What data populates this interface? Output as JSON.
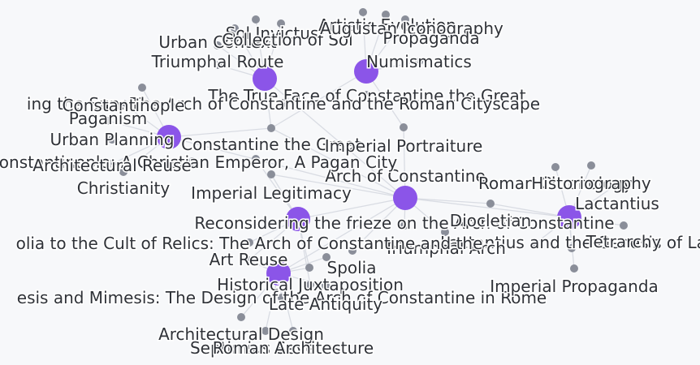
{
  "colors": {
    "hub": "#8b55e8",
    "leaf": "#8a8e99",
    "edge": "#d9dce3",
    "label": "#2f3238",
    "background": "#f7f8fa"
  },
  "nodes": [
    {
      "id": "arch",
      "kind": "hub",
      "label": "Arch of Constantine"
    },
    {
      "id": "truefaceH",
      "kind": "hub",
      "label": ""
    },
    {
      "id": "numisH",
      "kind": "hub",
      "label": ""
    },
    {
      "id": "cityH",
      "kind": "hub",
      "label": ""
    },
    {
      "id": "friezeH",
      "kind": "hub",
      "label": ""
    },
    {
      "id": "spoliaH",
      "kind": "hub",
      "label": ""
    },
    {
      "id": "lactH",
      "kind": "hub",
      "label": ""
    },
    {
      "id": "urbanctx",
      "kind": "leaf",
      "label": "Urban Context"
    },
    {
      "id": "triroute",
      "kind": "leaf",
      "label": "Triumphal Route"
    },
    {
      "id": "soliinv",
      "kind": "leaf",
      "label": "Sol Invictus"
    },
    {
      "id": "coll",
      "kind": "leaf",
      "label": "Collection of Sol"
    },
    {
      "id": "artevo",
      "kind": "leaf",
      "label": "Artistic Evolution"
    },
    {
      "id": "augico",
      "kind": "leaf",
      "label": "Augustan Iconography"
    },
    {
      "id": "prop",
      "kind": "leaf",
      "label": "Propaganda"
    },
    {
      "id": "numis",
      "kind": "leaf",
      "label": "Numismatics"
    },
    {
      "id": "trueface",
      "kind": "leaf",
      "label": "The True Face of Constantine the Great"
    },
    {
      "id": "sunarch",
      "kind": "leaf",
      "label": "ing the Sun: The Arch of Constantine and the Roman Cityscape"
    },
    {
      "id": "constop",
      "kind": "leaf",
      "label": "Constantinople"
    },
    {
      "id": "pagan",
      "kind": "leaf",
      "label": "Paganism"
    },
    {
      "id": "urbplan",
      "kind": "leaf",
      "label": "Urban Planning"
    },
    {
      "id": "constgreat",
      "kind": "leaf",
      "label": "Constantine the Great"
    },
    {
      "id": "imperport",
      "kind": "leaf",
      "label": "Imperial Portraiture"
    },
    {
      "id": "constpagan",
      "kind": "leaf",
      "label": "Constantinople: A Christian Emperor, A Pagan City"
    },
    {
      "id": "archreuse",
      "kind": "leaf",
      "label": "Architectural Reuse"
    },
    {
      "id": "christ",
      "kind": "leaf",
      "label": "Christianity"
    },
    {
      "id": "implegit",
      "kind": "leaf",
      "label": "Imperial Legitimacy"
    },
    {
      "id": "romchron",
      "kind": "leaf",
      "label": "Roman Chronology"
    },
    {
      "id": "histog",
      "kind": "leaf",
      "label": "Historiography"
    },
    {
      "id": "lact",
      "kind": "leaf",
      "label": "Lactantius"
    },
    {
      "id": "frieze",
      "kind": "leaf",
      "label": "Reconsidering the frieze on the Arch of Constantine"
    },
    {
      "id": "diocl",
      "kind": "leaf",
      "label": "Diocletian"
    },
    {
      "id": "genesis",
      "kind": "leaf",
      "label": "Lactantius and the Genesis of Late Antique"
    },
    {
      "id": "tetr",
      "kind": "leaf",
      "label": "Tetrarchy"
    },
    {
      "id": "triarch",
      "kind": "leaf",
      "label": "Triumphal Arch"
    },
    {
      "id": "relics",
      "kind": "leaf",
      "label": "olia to the Cult of Relics: The Arch of Constantine and the"
    },
    {
      "id": "artreuse",
      "kind": "leaf",
      "label": "Art Reuse"
    },
    {
      "id": "spolia",
      "kind": "leaf",
      "label": "Spolia"
    },
    {
      "id": "histjux",
      "kind": "leaf",
      "label": "Historical Juxtaposition"
    },
    {
      "id": "mimesis",
      "kind": "leaf",
      "label": "esis and Mimesis: The Design of the Arch of Constantine in Rome"
    },
    {
      "id": "lateant",
      "kind": "leaf",
      "label": "Late Antiquity"
    },
    {
      "id": "impprop",
      "kind": "leaf",
      "label": "Imperial Propaganda"
    },
    {
      "id": "archdes",
      "kind": "leaf",
      "label": "Architectural Design"
    },
    {
      "id": "sept",
      "kind": "leaf",
      "label": "Septimius Severus"
    },
    {
      "id": "romarch",
      "kind": "leaf",
      "label": "Roman Architecture"
    },
    {
      "id": "u1",
      "kind": "leaf",
      "label": ""
    },
    {
      "id": "u2",
      "kind": "leaf",
      "label": ""
    },
    {
      "id": "u3",
      "kind": "leaf",
      "label": ""
    },
    {
      "id": "u4",
      "kind": "leaf",
      "label": ""
    },
    {
      "id": "u5",
      "kind": "leaf",
      "label": ""
    },
    {
      "id": "u6",
      "kind": "leaf",
      "label": ""
    },
    {
      "id": "u7",
      "kind": "leaf",
      "label": ""
    }
  ],
  "edges": [
    [
      "truefaceH",
      "urbanctx"
    ],
    [
      "truefaceH",
      "triroute"
    ],
    [
      "truefaceH",
      "soliinv"
    ],
    [
      "truefaceH",
      "u1"
    ],
    [
      "truefaceH",
      "u2"
    ],
    [
      "truefaceH",
      "constgreat"
    ],
    [
      "truefaceH",
      "arch"
    ],
    [
      "numisH",
      "artevo"
    ],
    [
      "numisH",
      "augico"
    ],
    [
      "numisH",
      "prop"
    ],
    [
      "numisH",
      "numis"
    ],
    [
      "numisH",
      "imperport"
    ],
    [
      "numisH",
      "constgreat"
    ],
    [
      "cityH",
      "constop"
    ],
    [
      "cityH",
      "pagan"
    ],
    [
      "cityH",
      "urbplan"
    ],
    [
      "cityH",
      "archreuse"
    ],
    [
      "cityH",
      "christ"
    ],
    [
      "cityH",
      "constgreat"
    ],
    [
      "cityH",
      "arch"
    ],
    [
      "cityH",
      "u3"
    ],
    [
      "arch",
      "constgreat"
    ],
    [
      "arch",
      "imperport"
    ],
    [
      "arch",
      "implegit"
    ],
    [
      "arch",
      "frieze"
    ],
    [
      "arch",
      "triarch"
    ],
    [
      "arch",
      "diocl"
    ],
    [
      "arch",
      "lactH"
    ],
    [
      "arch",
      "spoliaH"
    ],
    [
      "arch",
      "friezeH"
    ],
    [
      "arch",
      "u4"
    ],
    [
      "friezeH",
      "implegit"
    ],
    [
      "friezeH",
      "relics"
    ],
    [
      "friezeH",
      "artreuse"
    ],
    [
      "friezeH",
      "spolia"
    ],
    [
      "friezeH",
      "histjux"
    ],
    [
      "friezeH",
      "u5"
    ],
    [
      "spoliaH",
      "artreuse"
    ],
    [
      "spoliaH",
      "spolia"
    ],
    [
      "spoliaH",
      "lateant"
    ],
    [
      "spoliaH",
      "archdes"
    ],
    [
      "spoliaH",
      "romarch"
    ],
    [
      "spoliaH",
      "sept"
    ],
    [
      "spoliaH",
      "u6"
    ],
    [
      "spoliaH",
      "mimesis"
    ],
    [
      "lactH",
      "romchron"
    ],
    [
      "lactH",
      "histog"
    ],
    [
      "lactH",
      "lact"
    ],
    [
      "lactH",
      "genesis"
    ],
    [
      "lactH",
      "tetr"
    ],
    [
      "lactH",
      "impprop"
    ],
    [
      "lactH",
      "u7"
    ],
    [
      "lactH",
      "diocl"
    ]
  ]
}
